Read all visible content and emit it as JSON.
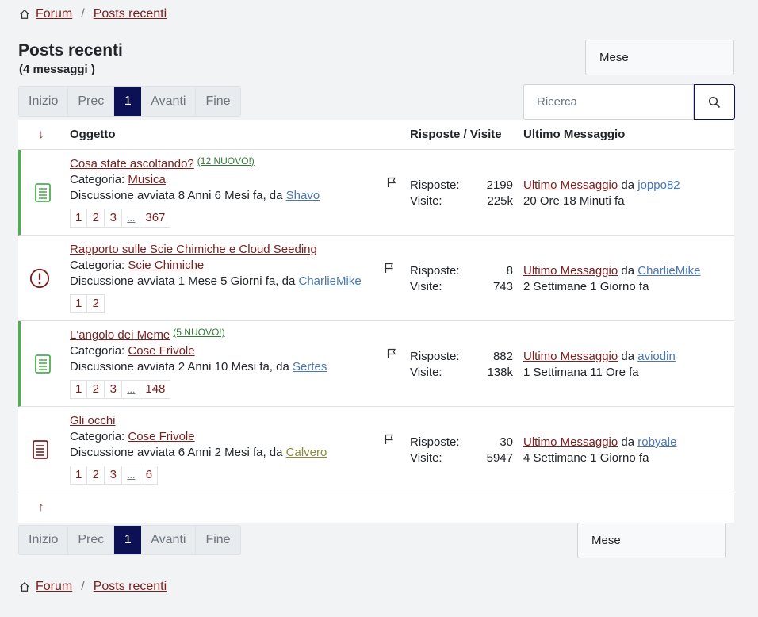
{
  "breadcrumb": {
    "forum": "Forum",
    "sep": "/",
    "current": "Posts recenti"
  },
  "header": {
    "title": "Posts recenti",
    "subtitle": "(4 messaggi )"
  },
  "period_select": {
    "value": "Mese"
  },
  "pagination": {
    "first": "Inizio",
    "prev": "Prec",
    "current": "1",
    "next": "Avanti",
    "last": "Fine"
  },
  "search": {
    "placeholder": "Ricerca"
  },
  "table": {
    "sort_arrow": "↓",
    "col_subject": "Oggetto",
    "col_stats": "Risposte / Visite",
    "col_last": "Ultimo Messaggio",
    "back_to_top": "↑",
    "rows": [
      {
        "title": "Cosa state ascoltando?",
        "new_badge": "(12 NUOVO!)",
        "category_label": "Categoria:",
        "category": "Musica",
        "started": "Discussione avviata 8 Anni 6 Mesi fa, da",
        "author": "Shavo",
        "pages": [
          "1",
          "2",
          "3",
          "...",
          "367"
        ],
        "replies_label": "Risposte:",
        "replies": "2199",
        "views_label": "Visite:",
        "views": "225k",
        "last_label": "Ultimo Messaggio",
        "by": "da",
        "last_user": "joppo82",
        "last_time": "20 Ore 18 Minuti fa"
      },
      {
        "title": "Rapporto sulle Scie Chimiche e Cloud Seeding",
        "new_badge": "",
        "category_label": "Categoria:",
        "category": "Scie Chimiche",
        "started": "Discussione avviata 1 Mese 5 Giorni fa, da",
        "author": "CharlieMike",
        "pages": [
          "1",
          "2"
        ],
        "replies_label": "Risposte:",
        "replies": "8",
        "views_label": "Visite:",
        "views": "743",
        "last_label": "Ultimo Messaggio",
        "by": "da",
        "last_user": "CharlieMike",
        "last_time": "2 Settimane 1 Giorno fa"
      },
      {
        "title": "L'angolo dei Meme",
        "new_badge": "(5 NUOVO!)",
        "category_label": "Categoria:",
        "category": "Cose Frivole",
        "started": "Discussione avviata 2 Anni 10 Mesi fa, da",
        "author": "Sertes",
        "pages": [
          "1",
          "2",
          "3",
          "...",
          "148"
        ],
        "replies_label": "Risposte:",
        "replies": "882",
        "views_label": "Visite:",
        "views": "138k",
        "last_label": "Ultimo Messaggio",
        "by": "da",
        "last_user": "aviodin",
        "last_time": "1 Settimana 11 Ore fa"
      },
      {
        "title": "Gli occhi",
        "new_badge": "",
        "category_label": "Categoria:",
        "category": "Cose Frivole",
        "started": "Discussione avviata 6 Anni 2 Mesi fa, da",
        "author": "Calvero",
        "pages": [
          "1",
          "2",
          "3",
          "...",
          "6"
        ],
        "replies_label": "Risposte:",
        "replies": "30",
        "views_label": "Visite:",
        "views": "5947",
        "last_label": "Ultimo Messaggio",
        "by": "da",
        "last_user": "robyale",
        "last_time": "4 Settimane 1 Giorno fa"
      }
    ]
  },
  "colors": {
    "accent": "#7a1e1e",
    "active_page": "#0c1155",
    "unread": "#4caf50",
    "user_link": "#4a77b4"
  }
}
